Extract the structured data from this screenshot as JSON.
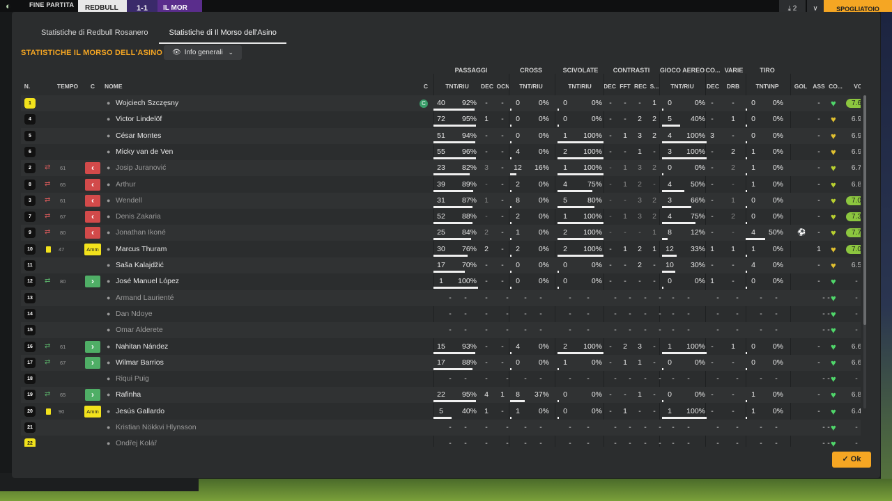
{
  "topbar": {
    "logo": "◐",
    "label": "FINE PARTITA",
    "team_a": "REDBULL",
    "score": "1-1",
    "team_b": "IL MOR",
    "download": "⤓ 2",
    "chevron": "∨",
    "button": "SPOGLIATOIO"
  },
  "tabs": [
    "Statistiche di Redbull Rosanero",
    "Statistiche di Il Morso dell'Asino"
  ],
  "section_title": "STATISTICHE IL MORSO DELL'ASINO",
  "dropdown": {
    "eye": "👁",
    "label": "Info generali",
    "caret": "⌄"
  },
  "groups": [
    "PASSAGGI",
    "CROSS",
    "SCIVOLATE",
    "CONTRASTI",
    "GIOCO AEREO",
    "CO...",
    "VARIE",
    "TIRO"
  ],
  "headers": [
    "N.",
    "TEMPO",
    "C",
    "NOME",
    "C",
    "TNT/RIU",
    "DEC",
    "OCN",
    "TNT/RIU",
    "TNT/RIU",
    "DEC",
    "FFT",
    "REC",
    "S...",
    "TNT/RIU",
    "DEC",
    "DRB",
    "TNT\\INP",
    "GOL",
    "ASS",
    "CO...",
    "VOT"
  ],
  "icons": {
    "person": "●",
    "swap": "⇄",
    "sub_out": "‹",
    "sub_in": "›",
    "heart": "♥",
    "ball": "⚽",
    "captain": "C",
    "check": "✓"
  },
  "rows": [
    {
      "n": "1",
      "gk": true,
      "min": "",
      "tag": "",
      "name": "Wojciech Szczęsny",
      "captain": true,
      "dim": false,
      "p": [
        "40",
        "92%"
      ],
      "pf": 0.92,
      "dec": "-",
      "ocn": "-",
      "cr": [
        "0",
        "0%"
      ],
      "crf": 0,
      "sc": [
        "0",
        "0%"
      ],
      "scf": 0,
      "ct": [
        "-",
        "-",
        "-",
        "1"
      ],
      "ga": [
        "0",
        "0%"
      ],
      "gaf": 0,
      "co": "-",
      "drb": "-",
      "ti": [
        "0",
        "0%"
      ],
      "tif": 0,
      "gol": "",
      "ass": "-",
      "heart": "#4fd66a",
      "vot": "7.6",
      "votc": "#8cc63f"
    },
    {
      "n": "4",
      "min": "",
      "tag": "",
      "name": "Victor Lindelöf",
      "dim": false,
      "p": [
        "72",
        "95%"
      ],
      "pf": 0.95,
      "dec": "1",
      "ocn": "-",
      "cr": [
        "0",
        "0%"
      ],
      "crf": 0,
      "sc": [
        "0",
        "0%"
      ],
      "scf": 0,
      "ct": [
        "-",
        "-",
        "2",
        "2"
      ],
      "ga": [
        "5",
        "40%"
      ],
      "gaf": 0.4,
      "co": "-",
      "drb": "1",
      "ti": [
        "0",
        "0%"
      ],
      "tif": 0,
      "gol": "",
      "ass": "-",
      "heart": "#e0c030",
      "vot": "6.9",
      "votc": ""
    },
    {
      "n": "5",
      "min": "",
      "tag": "",
      "name": "César Montes",
      "dim": false,
      "p": [
        "51",
        "94%"
      ],
      "pf": 0.94,
      "dec": "-",
      "ocn": "-",
      "cr": [
        "0",
        "0%"
      ],
      "crf": 0,
      "sc": [
        "1",
        "100%"
      ],
      "scf": 1,
      "ct": [
        "-",
        "1",
        "3",
        "2"
      ],
      "ga": [
        "4",
        "100%"
      ],
      "gaf": 1,
      "co": "3",
      "drb": "-",
      "ti": [
        "0",
        "0%"
      ],
      "tif": 0,
      "gol": "",
      "ass": "-",
      "heart": "#e0c030",
      "vot": "6.9",
      "votc": ""
    },
    {
      "n": "6",
      "min": "",
      "tag": "",
      "name": "Micky van de Ven",
      "dim": false,
      "p": [
        "55",
        "96%"
      ],
      "pf": 0.96,
      "dec": "-",
      "ocn": "-",
      "cr": [
        "4",
        "0%"
      ],
      "crf": 0,
      "sc": [
        "2",
        "100%"
      ],
      "scf": 1,
      "ct": [
        "-",
        "-",
        "1",
        "-"
      ],
      "ga": [
        "3",
        "100%"
      ],
      "gaf": 1,
      "co": "-",
      "drb": "2",
      "ti": [
        "1",
        "0%"
      ],
      "tif": 0,
      "gol": "",
      "ass": "-",
      "heart": "#e0c030",
      "vot": "6.9",
      "votc": ""
    },
    {
      "n": "2",
      "swap": true,
      "min": "61",
      "tag": "out",
      "name": "Josip Juranović",
      "dim": true,
      "p": [
        "23",
        "82%"
      ],
      "pf": 0.82,
      "dec": "3",
      "ocn": "-",
      "cr": [
        "12",
        "16%"
      ],
      "crf": 0.16,
      "sc": [
        "1",
        "100%"
      ],
      "scf": 1,
      "ct": [
        "-",
        "1",
        "3",
        "2"
      ],
      "ga": [
        "0",
        "0%"
      ],
      "gaf": 0,
      "co": "-",
      "drb": "2",
      "ti": [
        "1",
        "0%"
      ],
      "tif": 0,
      "gol": "",
      "ass": "-",
      "heart": "#b8d030",
      "vot": "6.7",
      "votc": ""
    },
    {
      "n": "8",
      "swap": true,
      "min": "65",
      "tag": "out",
      "name": "Arthur",
      "dim": true,
      "p": [
        "39",
        "89%"
      ],
      "pf": 0.89,
      "dec": "-",
      "ocn": "-",
      "cr": [
        "2",
        "0%"
      ],
      "crf": 0,
      "sc": [
        "4",
        "75%"
      ],
      "scf": 0.75,
      "ct": [
        "-",
        "1",
        "2",
        "-"
      ],
      "ga": [
        "4",
        "50%"
      ],
      "gaf": 0.5,
      "co": "-",
      "drb": "-",
      "ti": [
        "1",
        "0%"
      ],
      "tif": 0,
      "gol": "",
      "ass": "-",
      "heart": "#b8d030",
      "vot": "6.8",
      "votc": ""
    },
    {
      "n": "3",
      "swap": true,
      "min": "61",
      "tag": "out",
      "name": "Wendell",
      "dim": true,
      "p": [
        "31",
        "87%"
      ],
      "pf": 0.87,
      "dec": "1",
      "ocn": "-",
      "cr": [
        "8",
        "0%"
      ],
      "crf": 0,
      "sc": [
        "5",
        "80%"
      ],
      "scf": 0.8,
      "ct": [
        "-",
        "-",
        "3",
        "2"
      ],
      "ga": [
        "3",
        "66%"
      ],
      "gaf": 0.66,
      "co": "-",
      "drb": "1",
      "ti": [
        "0",
        "0%"
      ],
      "tif": 0,
      "gol": "",
      "ass": "-",
      "heart": "#b8d030",
      "vot": "7.0",
      "votc": "#8cc63f"
    },
    {
      "n": "7",
      "swap": true,
      "min": "67",
      "tag": "out",
      "name": "Denis Zakaria",
      "dim": true,
      "p": [
        "52",
        "88%"
      ],
      "pf": 0.88,
      "dec": "-",
      "ocn": "-",
      "cr": [
        "2",
        "0%"
      ],
      "crf": 0,
      "sc": [
        "1",
        "100%"
      ],
      "scf": 1,
      "ct": [
        "-",
        "1",
        "3",
        "2"
      ],
      "ga": [
        "4",
        "75%"
      ],
      "gaf": 0.75,
      "co": "-",
      "drb": "2",
      "ti": [
        "0",
        "0%"
      ],
      "tif": 0,
      "gol": "",
      "ass": "-",
      "heart": "#b8d030",
      "vot": "7.3",
      "votc": "#8cc63f"
    },
    {
      "n": "9",
      "swap": true,
      "min": "80",
      "tag": "out",
      "name": "Jonathan Ikoné",
      "dim": true,
      "p": [
        "25",
        "84%"
      ],
      "pf": 0.84,
      "dec": "2",
      "ocn": "-",
      "cr": [
        "1",
        "0%"
      ],
      "crf": 0,
      "sc": [
        "2",
        "100%"
      ],
      "scf": 1,
      "ct": [
        "-",
        "-",
        "-",
        "1"
      ],
      "ga": [
        "8",
        "12%"
      ],
      "gaf": 0.12,
      "co": "-",
      "drb": "-",
      "ti": [
        "4",
        "50%"
      ],
      "tif": 0.5,
      "gol": "ball",
      "ass": "-",
      "heart": "#b8d030",
      "vot": "7.7",
      "votc": "#8cc63f"
    },
    {
      "n": "10",
      "card": true,
      "min": "47",
      "tag": "amm",
      "name": "Marcus Thuram",
      "dim": false,
      "p": [
        "30",
        "76%"
      ],
      "pf": 0.76,
      "dec": "2",
      "ocn": "-",
      "cr": [
        "2",
        "0%"
      ],
      "crf": 0,
      "sc": [
        "2",
        "100%"
      ],
      "scf": 1,
      "ct": [
        "-",
        "1",
        "2",
        "1"
      ],
      "ga": [
        "12",
        "33%"
      ],
      "gaf": 0.33,
      "co": "1",
      "drb": "1",
      "ti": [
        "1",
        "0%"
      ],
      "tif": 0,
      "gol": "",
      "ass": "1",
      "heart": "#e0c030",
      "vot": "7.0",
      "votc": "#8cc63f"
    },
    {
      "n": "11",
      "min": "",
      "tag": "",
      "name": "Saša Kalajdžić",
      "dim": false,
      "p": [
        "17",
        "70%"
      ],
      "pf": 0.7,
      "dec": "-",
      "ocn": "-",
      "cr": [
        "0",
        "0%"
      ],
      "crf": 0,
      "sc": [
        "0",
        "0%"
      ],
      "scf": 0,
      "ct": [
        "-",
        "-",
        "2",
        "-"
      ],
      "ga": [
        "10",
        "30%"
      ],
      "gaf": 0.3,
      "co": "-",
      "drb": "-",
      "ti": [
        "4",
        "0%"
      ],
      "tif": 0,
      "gol": "",
      "ass": "-",
      "heart": "#e0c030",
      "vot": "6.5",
      "votc": ""
    },
    {
      "n": "12",
      "swapin": true,
      "min": "80",
      "tag": "in",
      "name": "José Manuel López",
      "dim": false,
      "p": [
        "1",
        "100%"
      ],
      "pf": 1,
      "dec": "-",
      "ocn": "-",
      "cr": [
        "0",
        "0%"
      ],
      "crf": 0,
      "sc": [
        "0",
        "0%"
      ],
      "scf": 0,
      "ct": [
        "-",
        "-",
        "-",
        "-"
      ],
      "ga": [
        "0",
        "0%"
      ],
      "gaf": 0,
      "co": "1",
      "drb": "-",
      "ti": [
        "0",
        "0%"
      ],
      "tif": 0,
      "gol": "",
      "ass": "-",
      "heart": "#4fd66a",
      "vot": "-",
      "votc": ""
    },
    {
      "n": "13",
      "min": "",
      "tag": "",
      "name": "Armand Laurienté",
      "dim": true,
      "empty": true,
      "heart": "#4fd66a",
      "vot": "-",
      "votc": ""
    },
    {
      "n": "14",
      "min": "",
      "tag": "",
      "name": "Dan Ndoye",
      "dim": true,
      "empty": true,
      "heart": "#4fd66a",
      "vot": "-",
      "votc": ""
    },
    {
      "n": "15",
      "min": "",
      "tag": "",
      "name": "Omar Alderete",
      "dim": true,
      "empty": true,
      "heart": "#4fd66a",
      "vot": "-",
      "votc": ""
    },
    {
      "n": "16",
      "swapin": true,
      "min": "61",
      "tag": "in",
      "name": "Nahitan Nández",
      "dim": false,
      "p": [
        "15",
        "93%"
      ],
      "pf": 0.93,
      "dec": "-",
      "ocn": "-",
      "cr": [
        "4",
        "0%"
      ],
      "crf": 0,
      "sc": [
        "2",
        "100%"
      ],
      "scf": 1,
      "ct": [
        "-",
        "2",
        "3",
        "-"
      ],
      "ga": [
        "1",
        "100%"
      ],
      "gaf": 1,
      "co": "-",
      "drb": "1",
      "ti": [
        "0",
        "0%"
      ],
      "tif": 0,
      "gol": "",
      "ass": "-",
      "heart": "#4fd66a",
      "vot": "6.6",
      "votc": ""
    },
    {
      "n": "17",
      "swapin": true,
      "min": "67",
      "tag": "in",
      "name": "Wilmar Barrios",
      "dim": false,
      "p": [
        "17",
        "88%"
      ],
      "pf": 0.88,
      "dec": "-",
      "ocn": "-",
      "cr": [
        "0",
        "0%"
      ],
      "crf": 0,
      "sc": [
        "1",
        "0%"
      ],
      "scf": 0,
      "ct": [
        "-",
        "1",
        "1",
        "-"
      ],
      "ga": [
        "0",
        "0%"
      ],
      "gaf": 0,
      "co": "-",
      "drb": "-",
      "ti": [
        "0",
        "0%"
      ],
      "tif": 0,
      "gol": "",
      "ass": "-",
      "heart": "#4fd66a",
      "vot": "6.6",
      "votc": ""
    },
    {
      "n": "18",
      "min": "",
      "tag": "",
      "name": "Riqui Puig",
      "dim": true,
      "empty": true,
      "heart": "#4fd66a",
      "vot": "-",
      "votc": ""
    },
    {
      "n": "19",
      "swapin": true,
      "min": "65",
      "tag": "in",
      "name": "Rafinha",
      "dim": false,
      "p": [
        "22",
        "95%"
      ],
      "pf": 0.95,
      "dec": "4",
      "ocn": "1",
      "cr": [
        "8",
        "37%"
      ],
      "crf": 0.37,
      "sc": [
        "0",
        "0%"
      ],
      "scf": 0,
      "ct": [
        "-",
        "-",
        "1",
        "-"
      ],
      "ga": [
        "0",
        "0%"
      ],
      "gaf": 0,
      "co": "-",
      "drb": "-",
      "ti": [
        "1",
        "0%"
      ],
      "tif": 0,
      "gol": "",
      "ass": "-",
      "heart": "#4fd66a",
      "vot": "6.8",
      "votc": ""
    },
    {
      "n": "20",
      "card": true,
      "min": "90",
      "tag": "amm",
      "name": "Jesús Gallardo",
      "dim": false,
      "p": [
        "5",
        "40%"
      ],
      "pf": 0.4,
      "dec": "1",
      "ocn": "-",
      "cr": [
        "1",
        "0%"
      ],
      "crf": 0,
      "sc": [
        "0",
        "0%"
      ],
      "scf": 0,
      "ct": [
        "-",
        "1",
        "-",
        "-"
      ],
      "ga": [
        "1",
        "100%"
      ],
      "gaf": 1,
      "co": "-",
      "drb": "-",
      "ti": [
        "1",
        "0%"
      ],
      "tif": 0,
      "gol": "",
      "ass": "-",
      "heart": "#4fd66a",
      "vot": "6.4",
      "votc": ""
    },
    {
      "n": "21",
      "min": "",
      "tag": "",
      "name": "Kristian Nökkvi Hlynsson",
      "dim": true,
      "empty": true,
      "heart": "#4fd66a",
      "vot": "-",
      "votc": ""
    },
    {
      "n": "22",
      "gk": true,
      "min": "",
      "tag": "",
      "name": "Ondřej Kolář",
      "dim": true,
      "empty": true,
      "heart": "#4fd66a",
      "vot": "-",
      "votc": ""
    }
  ],
  "amm_label": "Amm",
  "ok_button": "Ok"
}
